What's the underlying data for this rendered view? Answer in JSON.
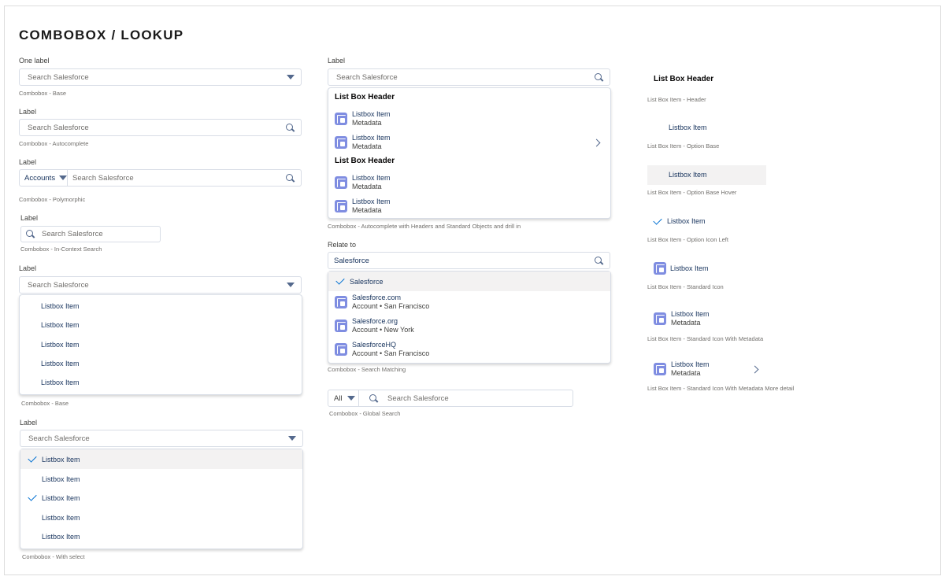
{
  "page_title": "COMBOBOX / LOOKUP",
  "placeholder": "Search Salesforce",
  "item": "Listbox Item",
  "metadata": "Metadata",
  "header": "List Box Header",
  "left": {
    "base": {
      "label": "One label",
      "caption": "Combobox - Base"
    },
    "autocomplete": {
      "label": "Label",
      "caption": "Combobox - Autocomplete"
    },
    "polymorphic": {
      "label": "Label",
      "object": "Accounts",
      "caption": "Combobox - Polymorphic"
    },
    "incontext": {
      "label": "Label",
      "caption": "Combobox - In-Context Search"
    },
    "base_open": {
      "label": "Label",
      "caption": "Combobox - Base"
    },
    "with_select": {
      "label": "Label",
      "caption": "Combobox - With select",
      "selected": [
        true,
        false,
        true,
        false,
        false
      ]
    }
  },
  "middle": {
    "headers": {
      "label": "Label",
      "caption": "Combobox - Autocomplete with Headers and Standard Objects and drill in"
    },
    "matching": {
      "label": "Relate to",
      "value": "Salesforce",
      "caption": "Combobox - Search Matching",
      "selected": "Salesforce",
      "results": [
        {
          "name": "Salesforce.com",
          "meta": "Account • San Francisco"
        },
        {
          "name": "Salesforce.org",
          "meta": "Account • New York"
        },
        {
          "name": "SalesforceHQ",
          "meta": "Account • San Francisco"
        }
      ]
    },
    "global": {
      "scope": "All",
      "caption": "Combobox - Global Search"
    }
  },
  "right": {
    "captions": [
      "List Box Item - Header",
      "List Box Item - Option Base",
      "List Box Item - Option Base Hover",
      "List Box Item - Option Icon Left",
      "List Box Item - Standard Icon",
      "List Box Item - Standard Icon With Metadata",
      "List Box Item - Standard Icon With Metadata More detail"
    ]
  },
  "colors": {
    "accent": "#0070d2",
    "icon": "#7f8de1",
    "hover": "#f3f2f2"
  }
}
